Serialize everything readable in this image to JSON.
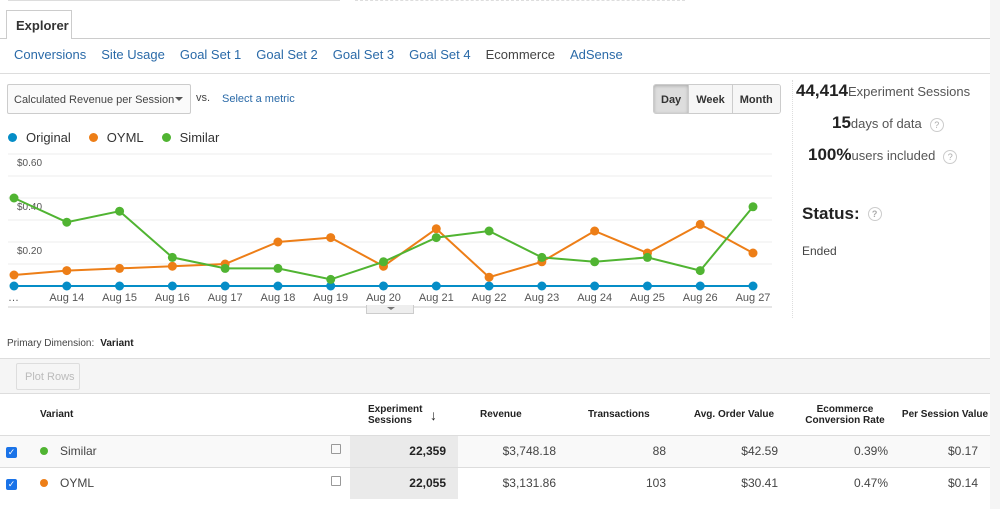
{
  "tab": "Explorer",
  "subnav": [
    {
      "label": "Conversions"
    },
    {
      "label": "Site Usage"
    },
    {
      "label": "Goal Set 1"
    },
    {
      "label": "Goal Set 2"
    },
    {
      "label": "Goal Set 3"
    },
    {
      "label": "Goal Set 4"
    },
    {
      "label": "Ecommerce",
      "current": true
    },
    {
      "label": "AdSense"
    }
  ],
  "metric": {
    "selected": "Calculated Revenue per Session",
    "vs": "vs.",
    "select_metric": "Select a metric"
  },
  "granularity": [
    "Day",
    "Week",
    "Month"
  ],
  "granularity_selected": "Day",
  "stats": {
    "sessions": "44,414",
    "sessions_label": "Experiment Sessions",
    "days": "15",
    "days_label": "days of data",
    "users": "100%",
    "users_label": "users included",
    "status_label": "Status:",
    "status": "Ended",
    "help": "?"
  },
  "chart_data": {
    "type": "line",
    "categories": [
      "…",
      "Aug 14",
      "Aug 15",
      "Aug 16",
      "Aug 17",
      "Aug 18",
      "Aug 19",
      "Aug 20",
      "Aug 21",
      "Aug 22",
      "Aug 23",
      "Aug 24",
      "Aug 25",
      "Aug 26",
      "Aug 27"
    ],
    "yticks": [
      "$0.20",
      "$0.40",
      "$0.60"
    ],
    "ytick_values": [
      0.2,
      0.4,
      0.6
    ],
    "ylim": [
      0,
      0.6
    ],
    "grid": true,
    "legend": "top-left",
    "series": [
      {
        "name": "Original",
        "color": "#058dc7",
        "values": [
          0,
          0,
          0,
          0,
          0,
          0,
          0,
          0,
          0,
          0,
          0,
          0,
          0,
          0,
          0
        ]
      },
      {
        "name": "OYML",
        "color": "#ed7e17",
        "values": [
          0.05,
          0.07,
          0.08,
          0.09,
          0.1,
          0.2,
          0.22,
          0.09,
          0.26,
          0.04,
          0.11,
          0.25,
          0.15,
          0.28,
          0.15
        ]
      },
      {
        "name": "Similar",
        "color": "#50b432",
        "values": [
          0.4,
          0.29,
          0.34,
          0.13,
          0.08,
          0.08,
          0.03,
          0.11,
          0.22,
          0.25,
          0.13,
          0.11,
          0.13,
          0.07,
          0.36
        ]
      }
    ]
  },
  "primary_dimension": {
    "label": "Primary Dimension:",
    "value": "Variant"
  },
  "plot_rows": "Plot Rows",
  "table": {
    "headers": [
      "Variant",
      "Experiment Sessions",
      "Revenue",
      "Transactions",
      "Avg. Order Value",
      "Ecommerce Conversion Rate",
      "Per Session Value"
    ],
    "sort_icon": "arrow-down",
    "rows": [
      {
        "variant": "Similar",
        "color": "#50b432",
        "sessions": "22,359",
        "revenue": "$3,748.18",
        "transactions": "88",
        "aov": "$42.59",
        "cr": "0.39%",
        "psv": "$0.17"
      },
      {
        "variant": "OYML",
        "color": "#ed7e17",
        "sessions": "22,055",
        "revenue": "$3,131.86",
        "transactions": "103",
        "aov": "$30.41",
        "cr": "0.47%",
        "psv": "$0.14"
      }
    ]
  }
}
